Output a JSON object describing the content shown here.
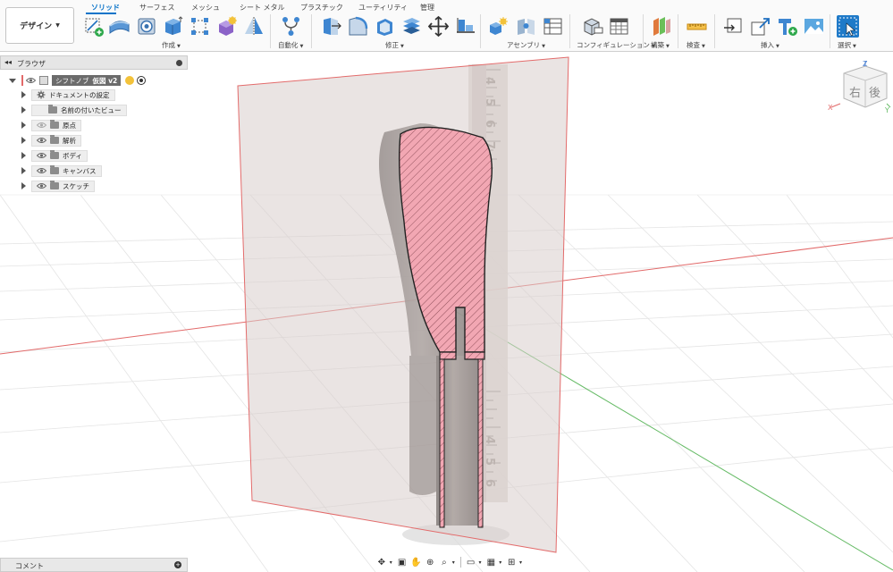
{
  "workspace": {
    "label": "デザイン",
    "caret": "▼"
  },
  "tabs": [
    {
      "label": "ソリッド",
      "active": true
    },
    {
      "label": "サーフェス"
    },
    {
      "label": "メッシュ"
    },
    {
      "label": "シート メタル"
    },
    {
      "label": "プラスチック"
    },
    {
      "label": "ユーティリティ"
    },
    {
      "label": "管理"
    }
  ],
  "groups": [
    {
      "label": "作成"
    },
    {
      "label": "自動化"
    },
    {
      "label": "修正"
    },
    {
      "label": "アセンブリ"
    },
    {
      "label": "コンフィギュレーション"
    },
    {
      "label": "構築"
    },
    {
      "label": "検査"
    },
    {
      "label": "挿入"
    },
    {
      "label": "選択"
    }
  ],
  "group_caret": "▼",
  "browser": {
    "title": "ブラウザ",
    "collapse_icon": "◂◂",
    "root": {
      "name": "シフトノブ",
      "version": "仮図 v2"
    },
    "items": [
      {
        "label": "ドキュメントの設定",
        "icon": "gear-icon"
      },
      {
        "label": "名前の付いたビュー",
        "icon": "folder-icon"
      },
      {
        "label": "原点",
        "icon": "folder-icon",
        "eye": "hidden"
      },
      {
        "label": "解析",
        "icon": "folder-icon",
        "eye": "visible"
      },
      {
        "label": "ボディ",
        "icon": "folder-icon",
        "eye": "visible"
      },
      {
        "label": "キャンバス",
        "icon": "folder-icon",
        "eye": "visible"
      },
      {
        "label": "スケッチ",
        "icon": "folder-icon",
        "eye": "visible"
      }
    ]
  },
  "viewcube": {
    "face_front": "右",
    "face_back": "後",
    "axis_x": "X",
    "axis_y": "Y",
    "axis_z": "Z"
  },
  "comments": {
    "label": "コメント",
    "add_icon": "+"
  },
  "ruler_marks": [
    "4",
    "5",
    "6",
    "7",
    "4",
    "5",
    "6"
  ],
  "colors": {
    "accent": "#0b74c9",
    "section_fill": "#f2a7b3",
    "section_plane": "#d9cdcc",
    "plane_edge": "#e36b6b",
    "body_dark": "#5a5552",
    "grid_line": "#e2e2e2",
    "axis_red": "#e26a6a",
    "axis_green": "#66bb66"
  },
  "nav_icons": [
    "orbit-icon",
    "look-at-icon",
    "pan-icon",
    "zoom-fit-icon",
    "zoom-icon",
    "display-settings-icon",
    "grid-settings-icon",
    "viewports-icon"
  ]
}
